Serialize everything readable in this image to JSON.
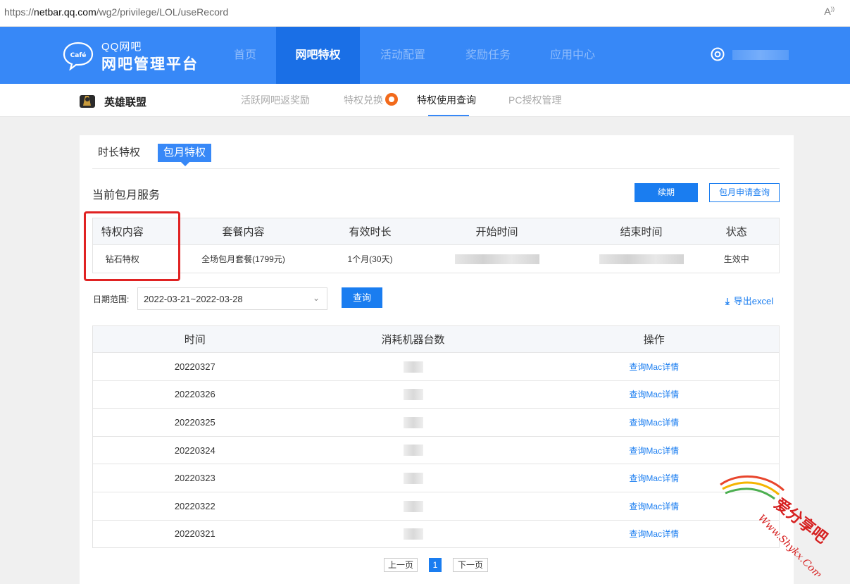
{
  "browser": {
    "url_prefix": "https://",
    "url_host": "netbar.qq.com",
    "url_path": "/wg2/privilege/LOL/useRecord",
    "reader_icon": "A"
  },
  "header": {
    "logo_line1": "QQ网吧",
    "logo_line2": "网吧管理平台",
    "logo_badge": "Café",
    "nav": [
      {
        "label": "首页",
        "active": false
      },
      {
        "label": "网吧特权",
        "active": true
      },
      {
        "label": "活动配置",
        "active": false
      },
      {
        "label": "奖励任务",
        "active": false
      },
      {
        "label": "应用中心",
        "active": false
      }
    ],
    "user_icon": "gear-icon"
  },
  "subnav": {
    "game_name": "英雄联盟",
    "items": [
      {
        "label": "活跃网吧返奖励",
        "active": false
      },
      {
        "label": "特权兑换",
        "active": false,
        "hot": true
      },
      {
        "label": "特权使用查询",
        "active": true
      },
      {
        "label": "PC授权管理",
        "active": false
      }
    ]
  },
  "tabs": {
    "duration": "时长特权",
    "monthly": "包月特权"
  },
  "service": {
    "title": "当前包月服务",
    "renew_label": "续期",
    "apply_query_label": "包月申请查询",
    "columns": [
      "特权内容",
      "套餐内容",
      "有效时长",
      "开始时间",
      "结束时间",
      "状态"
    ],
    "row": {
      "content": "钻石特权",
      "package": "全场包月套餐(1799元)",
      "duration": "1个月(30天)",
      "status": "生效中"
    }
  },
  "filter": {
    "label": "日期范围:",
    "date_range": "2022-03-21~2022-03-28",
    "query_label": "查询",
    "export_label": "导出excel"
  },
  "records": {
    "columns": [
      "时间",
      "消耗机器台数",
      "操作"
    ],
    "action_label": "查询Mac详情",
    "rows": [
      {
        "date": "20220327"
      },
      {
        "date": "20220326"
      },
      {
        "date": "20220325"
      },
      {
        "date": "20220324"
      },
      {
        "date": "20220323"
      },
      {
        "date": "20220322"
      },
      {
        "date": "20220321"
      }
    ]
  },
  "pager": {
    "prev": "上一页",
    "current": "1",
    "next": "下一页"
  },
  "watermark": {
    "line1": "爱分享吧",
    "line2": "Www.Shykx.Com"
  },
  "colors": {
    "primary": "#3788f7",
    "nav_active": "#1a6fe6",
    "link": "#1a7df0",
    "highlight_box": "#e02222"
  }
}
